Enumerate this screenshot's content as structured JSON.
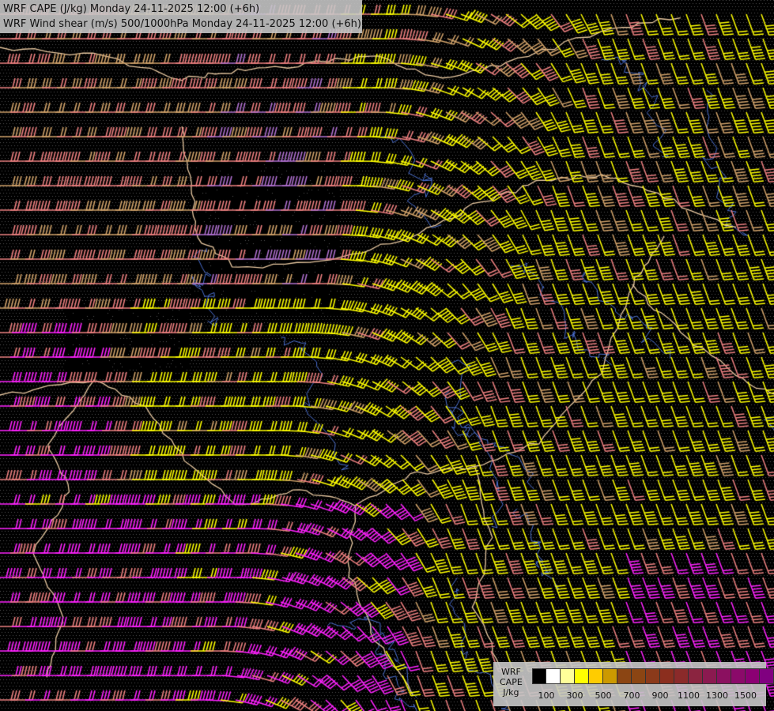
{
  "header": {
    "line1": "WRF CAPE (J/kg) Monday 24-11-2025 12:00 (+6h)",
    "line2": "WRF Wind shear (m/s) 500/1000hPa Monday 24-11-2025 12:00 (+6h)"
  },
  "legend": {
    "model": "WRF",
    "variable": "CAPE",
    "unit": "J/kg",
    "colors": [
      "#000000",
      "#ffffff",
      "#ffff99",
      "#ffff00",
      "#ffcc00",
      "#cc9900",
      "#8b4513",
      "#8b4513",
      "#8b3a1a",
      "#8b2e1e",
      "#8b2a2a",
      "#8b2440",
      "#8b1a50",
      "#8b1060",
      "#8b0a6a",
      "#8b0073",
      "#800080"
    ],
    "tick_labels": [
      "100",
      "300",
      "500",
      "700",
      "900",
      "1100",
      "1300",
      "1500"
    ]
  },
  "layer_colors": {
    "barb_yellow": "#ffff00",
    "barb_tan": "#d2a36a",
    "barb_salmon": "#ee8080",
    "barb_magenta": "#ff22ff",
    "barb_violet": "#b070d0",
    "border": "#e8c8a0",
    "river": "#4a6fd0"
  }
}
